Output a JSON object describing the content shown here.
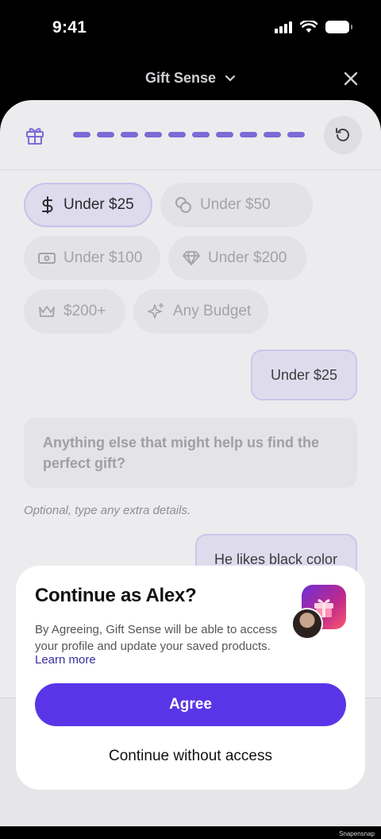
{
  "status_bar": {
    "time": "9:41"
  },
  "header": {
    "title": "Gift Sense"
  },
  "progress": {
    "segments": 10
  },
  "budget_options": [
    {
      "label": "Under $25",
      "icon": "dollar-icon",
      "selected": true
    },
    {
      "label": "Under $50",
      "icon": "coins-icon",
      "selected": false
    },
    {
      "label": "Under $100",
      "icon": "banknote-icon",
      "selected": false
    },
    {
      "label": "Under $200",
      "icon": "diamond-icon",
      "selected": false
    },
    {
      "label": "$200+",
      "icon": "crown-icon",
      "selected": false
    },
    {
      "label": "Any Budget",
      "icon": "sparkles-icon",
      "selected": false
    }
  ],
  "chat": {
    "user_reply_1": "Under $25",
    "bot_question": "Anything else that might help us find the perfect gift?",
    "hint": "Optional, type any extra details.",
    "user_reply_2": "He likes black color"
  },
  "dialog": {
    "title": "Continue as Alex?",
    "body": "By Agreeing, Gift Sense will be able to access your profile and update your saved products.",
    "learn_more": "Learn more",
    "agree_label": "Agree",
    "continue_label": "Continue without access",
    "accent_color": "#5a35e8"
  },
  "watermark": "Snapensnap"
}
